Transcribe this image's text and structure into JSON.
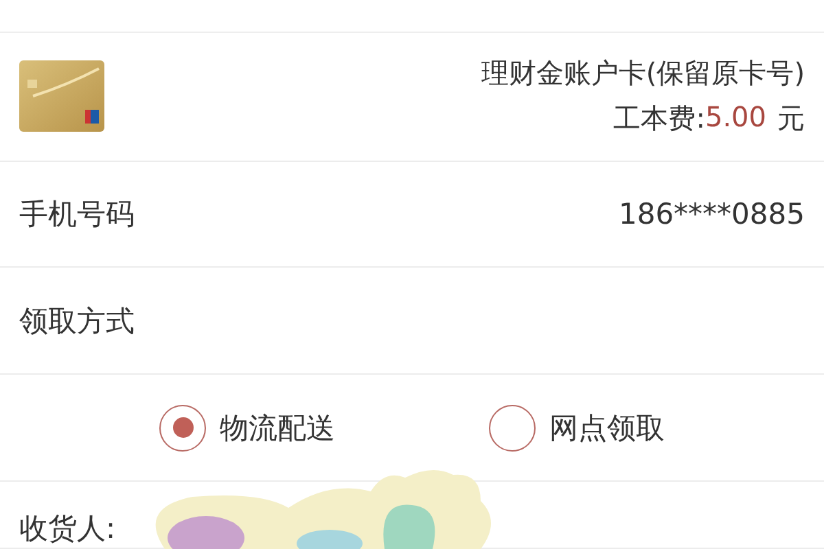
{
  "card": {
    "name": "理财金账户卡(保留原卡号)",
    "fee_label": "工本费:",
    "fee_amount": "5.00",
    "fee_unit": "元"
  },
  "phone": {
    "label": "手机号码",
    "value": "186****0885"
  },
  "pickup": {
    "label": "领取方式",
    "options": [
      {
        "label": "物流配送",
        "selected": true
      },
      {
        "label": "网点领取",
        "selected": false
      }
    ]
  },
  "receiver": {
    "label": "收货人:"
  }
}
